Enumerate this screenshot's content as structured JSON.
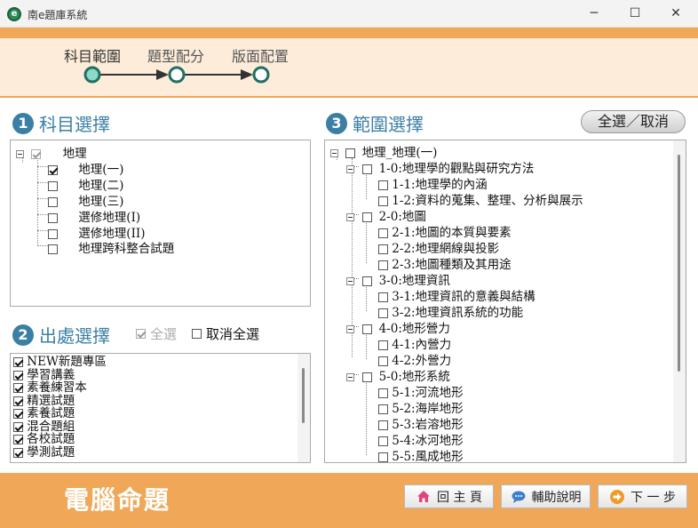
{
  "window": {
    "title": "南e題庫系統",
    "icon": "app-logo-icon"
  },
  "steps": [
    {
      "label": "科目範圍",
      "active": true
    },
    {
      "label": "題型配分",
      "active": false
    },
    {
      "label": "版面配置",
      "active": false
    }
  ],
  "section1": {
    "number": "1",
    "title": "科目選擇",
    "root": "地理",
    "items": [
      {
        "label": "地理(一)",
        "checked": true
      },
      {
        "label": "地理(二)",
        "checked": false
      },
      {
        "label": "地理(三)",
        "checked": false
      },
      {
        "label": "選修地理(I)",
        "checked": false
      },
      {
        "label": "選修地理(II)",
        "checked": false
      },
      {
        "label": "地理跨科整合試題",
        "checked": false
      }
    ]
  },
  "section2": {
    "number": "2",
    "title": "出處選擇",
    "select_all": "全選",
    "deselect_all": "取消全選",
    "items": [
      {
        "label": "NEW新題專區",
        "checked": true
      },
      {
        "label": "學習講義",
        "checked": true
      },
      {
        "label": "素養練習本",
        "checked": true
      },
      {
        "label": "精選試題",
        "checked": true
      },
      {
        "label": "素養試題",
        "checked": true
      },
      {
        "label": "混合題組",
        "checked": true
      },
      {
        "label": "各校試題",
        "checked": true
      },
      {
        "label": "學測試題",
        "checked": true
      }
    ]
  },
  "section3": {
    "number": "3",
    "title": "範圍選擇",
    "toggle_button": "全選／取消",
    "root": "地理_地理(一)",
    "chapters": [
      {
        "label": "1-0:地理學的觀點與研究方法",
        "children": [
          "1-1:地理學的內涵",
          "1-2:資料的蒐集、整理、分析與展示"
        ]
      },
      {
        "label": "2-0:地圖",
        "children": [
          "2-1:地圖的本質與要素",
          "2-2:地理網線與投影",
          "2-3:地圖種類及其用途"
        ]
      },
      {
        "label": "3-0:地理資訊",
        "children": [
          "3-1:地理資訊的意義與結構",
          "3-2:地理資訊系統的功能"
        ]
      },
      {
        "label": "4-0:地形營力",
        "children": [
          "4-1:內營力",
          "4-2:外營力"
        ]
      },
      {
        "label": "5-0:地形系統",
        "children": [
          "5-1:河流地形",
          "5-2:海岸地形",
          "5-3:岩溶地形",
          "5-4:冰河地形",
          "5-5:風成地形"
        ]
      }
    ]
  },
  "bottom": {
    "title": "電腦命題",
    "home": "回 主 頁",
    "help": "輔助說明",
    "next": "下 一 步"
  },
  "colors": {
    "accent": "#f0a858",
    "section": "#3b7fa4",
    "step_line": "#333333",
    "step_node": "#2e8b7a"
  }
}
